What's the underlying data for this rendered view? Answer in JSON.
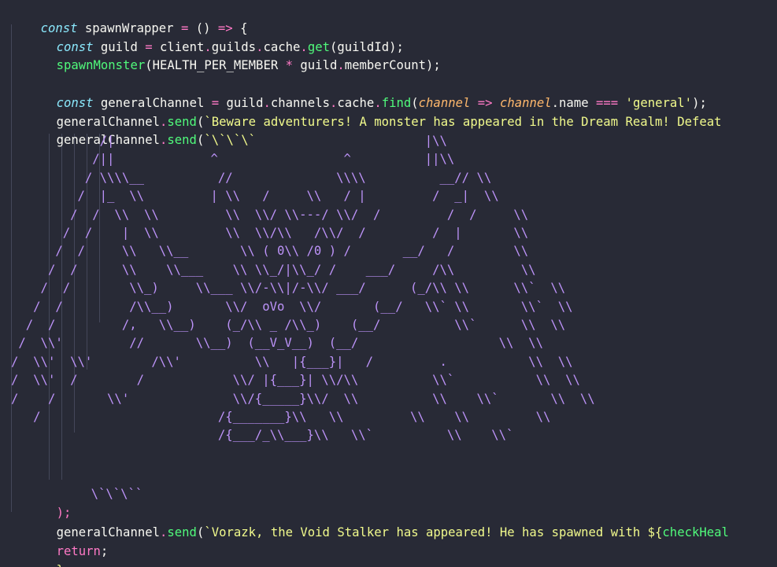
{
  "colors": {
    "background": "#282a36",
    "keyword": "#8be9fd",
    "identifier": "#f8f8f2",
    "function": "#50fa7b",
    "operator": "#ff79c6",
    "string": "#f1fa8c",
    "parameter": "#ffb86c",
    "ascii_art_purple": "#bd93f9",
    "indent_guide": "#44475a"
  },
  "code": {
    "l1": {
      "k": "const",
      "a": " spawnWrapper ",
      "b": "=",
      "c": " () ",
      "d": "=>",
      "e": " {"
    },
    "l2": {
      "k": "const",
      "a": " guild ",
      "b": "=",
      "c": " client",
      "d": ".",
      "e": "guilds",
      "f": ".",
      "g": "cache",
      "h": ".",
      "i": "get",
      "j": "(guildId);"
    },
    "l3": {
      "a": "spawnMonster",
      "b": "(HEALTH_PER_MEMBER ",
      "c": "*",
      "d": " guild",
      "e": ".",
      "f": "memberCount);"
    },
    "l5": {
      "k": "const",
      "a": " generalChannel ",
      "b": "=",
      "c": " guild",
      "d": ".",
      "e": "channels",
      "f": ".",
      "g": "cache",
      "h": ".",
      "i": "find",
      "j": "(",
      "p1": "channel",
      "m": " => ",
      "p2": "channel",
      "n": ".name ",
      "o": "===",
      "s": " 'general'",
      "t": ");"
    },
    "l6": {
      "a": "generalChannel",
      "b": ".",
      "c": "send",
      "d": "(",
      "s": "`Beware adventurers! A monster has appeared in the Dream Realm! Defeat"
    },
    "l7": {
      "a": "generalChannel",
      "b": ".",
      "c": "send",
      "d": "(",
      "s": "`\\`\\`\\`"
    },
    "art": [
      "            /|                                          |\\\\",
      "           /||             ^                 ^          ||\\\\",
      "          / \\\\\\\\__          //              \\\\\\\\          __// \\\\",
      "         /  |_  \\\\         | \\\\   /     \\\\   / |         /  _|  \\\\",
      "        /  /  \\\\  \\\\         \\\\  \\\\/ \\\\---/ \\\\/  /         /  /     \\\\",
      "       /  /    |  \\\\         \\\\  \\\\/\\\\   /\\\\/  /         /  |       \\\\",
      "      /  /     \\\\   \\\\__       \\\\ ( 0\\\\ /0 ) /       __/   /        \\\\",
      "     /  /      \\\\    \\\\___    \\\\ \\\\_/|\\\\_/ /    ___/     /\\\\         \\\\",
      "    /  /        \\\\_)     \\\\___ \\\\/-\\\\|/-\\\\/ ___/      (_/\\\\ \\\\      \\\\`  \\\\",
      "   /  /         /\\\\__)       \\\\/  oVo  \\\\/       (__/   \\\\` \\\\       \\\\`  \\\\",
      "  /  /         /,   \\\\__)    (_/\\\\ _ /\\\\_)    (__/          \\\\`      \\\\  \\\\",
      " /  \\\\'         //       \\\\__)  (__V_V__)  (__/                   \\\\  \\\\",
      "/  \\\\'  \\\\'        /\\\\'          \\\\   |{___}|   /         .           \\\\  \\\\",
      "/  \\\\'  /        /            \\\\/ |{___}| \\\\/\\\\          \\\\`           \\\\  \\\\",
      "/    /       \\\\'              \\\\/{_____}\\\\/  \\\\          \\\\    \\\\`       \\\\  \\\\",
      "   /                        /{_______}\\\\   \\\\         \\\\    \\\\         \\\\",
      "                            /{___/_\\\\___}\\\\   \\\\`          \\\\    \\\\`"
    ],
    "l25": {
      "s": "\\`\\`\\``"
    },
    "l26": {
      "a": ");"
    },
    "l27": {
      "a": "generalChannel",
      "b": ".",
      "c": "send",
      "d": "(",
      "s": "`Vorazk, the Void Stalker has appeared! He has spawned with ${",
      "f": "checkHeal"
    },
    "l28": {
      "k": "return",
      "a": ";"
    },
    "l29": {
      "a": "};"
    }
  }
}
